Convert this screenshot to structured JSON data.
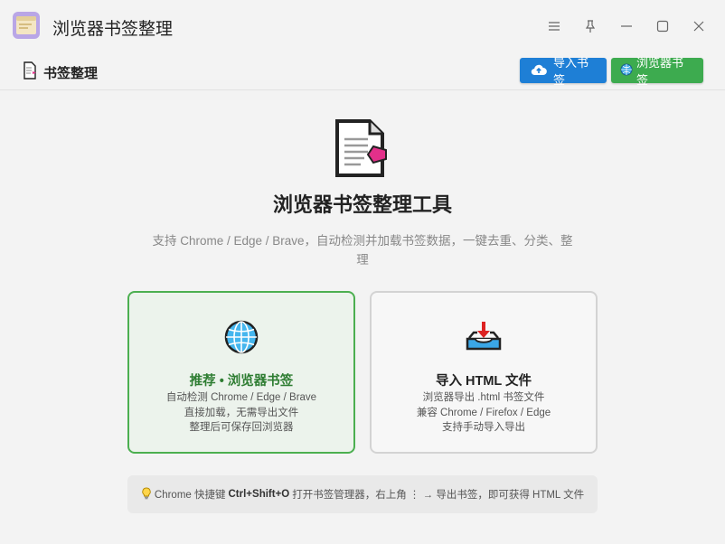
{
  "window": {
    "title": "浏览器书签整理",
    "icons": [
      "menu-icon",
      "pin-icon",
      "minimize-icon",
      "maximize-icon",
      "close-icon"
    ]
  },
  "header": {
    "title": "书签整理",
    "import_button": "导入书签",
    "browser_button": "浏览器书签"
  },
  "hero": {
    "title": "浏览器书签整理工具",
    "subtitle": "支持 Chrome / Edge / Brave，自动检测并加载书签数据，一键去重、分类、整理"
  },
  "cards": {
    "browser": {
      "title": "推荐 • 浏览器书签",
      "lines": [
        "自动检测 Chrome / Edge / Brave",
        "直接加载，无需导出文件",
        "整理后可保存回浏览器"
      ]
    },
    "html": {
      "title": "导入 HTML 文件",
      "lines": [
        "浏览器导出 .html 书签文件",
        "兼容 Chrome / Firefox / Edge",
        "支持手动导入导出"
      ]
    }
  },
  "tip": {
    "prefix": "Chrome 快捷键",
    "shortcut": "Ctrl+Shift+O",
    "suffix": "打开书签管理器，右上角 ⋮ → 导出书签，即可获得 HTML 文件"
  },
  "colors": {
    "primary": "#1e7fd6",
    "success": "#3dab4f",
    "success_border": "#4caf50",
    "success_text": "#2e7d32"
  }
}
